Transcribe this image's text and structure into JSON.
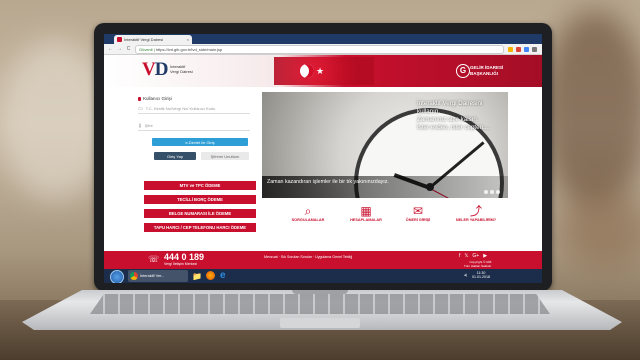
{
  "browser": {
    "tab_title": "İnteraktif Vergi Dairesi",
    "url_secure": "Güvenli",
    "url_path": "https://ivd.gib.gov.tr/tvd_side/main.jsp",
    "close_glyph": "×",
    "nav": {
      "back": "←",
      "forward": "→",
      "reload": "C"
    }
  },
  "header": {
    "logo_v": "V",
    "logo_d": "D",
    "logo_sub_line1": "İnteraktif",
    "logo_sub_line2": "Vergi Dairesi",
    "star": "★",
    "gib_glyph": "G",
    "gib_line1": "GELİR İDARESİ",
    "gib_line2": "BAŞKANLIĞI"
  },
  "login": {
    "title": "Kullanıcı Girişi",
    "user_placeholder": "T.C. Kimlik No/Vergi No/ Kullanıcı Kodu",
    "password_placeholder": "Şifre",
    "edevlet_button": "e-Devlet ile Giriş",
    "submit_button": "Giriş Yap",
    "forgot_button": "Şifremi Unuttum"
  },
  "quick_payments": [
    {
      "label": "MTV ve TPC ÖDEME"
    },
    {
      "label": "TECİLLİ BORÇ ÖDEME"
    },
    {
      "label": "BELGE NUMARASI İLE ÖDEME"
    },
    {
      "label": "TAPU HARCI / CEP TELEFONU HARCI ÖDEME"
    }
  ],
  "hero": {
    "text_line1": "İnteraktif Vergi Dairesini kullanın.",
    "text_line2": "Zamanınız size kalsın.",
    "text_line3": "İster evden, ister cepten....",
    "caption": "Zaman kazandıran işlemler ile bir tık yakınınızdayız."
  },
  "quick_links": [
    {
      "label": "SORGULAMALAR",
      "icon": "search-icon",
      "glyph": "⌕"
    },
    {
      "label": "HESAPLAMALAR",
      "icon": "calculator-icon",
      "glyph": "▦"
    },
    {
      "label": "ÖNERİ GİRİŞİ",
      "icon": "envelope-icon",
      "glyph": "✉"
    },
    {
      "label": "NELER YAPABİLİRİM?",
      "icon": "info-icon",
      "glyph": "⤴"
    }
  ],
  "footer": {
    "phone": "444 0 189",
    "phone_sub": "Vergi İletişim Merkezi",
    "phone_glyph": "☏",
    "links": "Mevzuat · Sık Sorulan Sorular · Uygulama Genel Tebliğ",
    "social": [
      "f",
      "𝕏",
      "G+",
      "▶"
    ],
    "copyright": "Copyright © GİB",
    "copyright_sub": "Tüm Hakları Saklıdır"
  },
  "taskbar": {
    "chrome_label": "İnteraktif Ver...",
    "folder_glyph": "📁",
    "ie_glyph": "e",
    "time": "11:30",
    "date": "01.01.2018"
  },
  "colors": {
    "brand_red": "#c8102e",
    "brand_navy": "#1f3a67",
    "edevlet_blue": "#2e9fd6"
  }
}
